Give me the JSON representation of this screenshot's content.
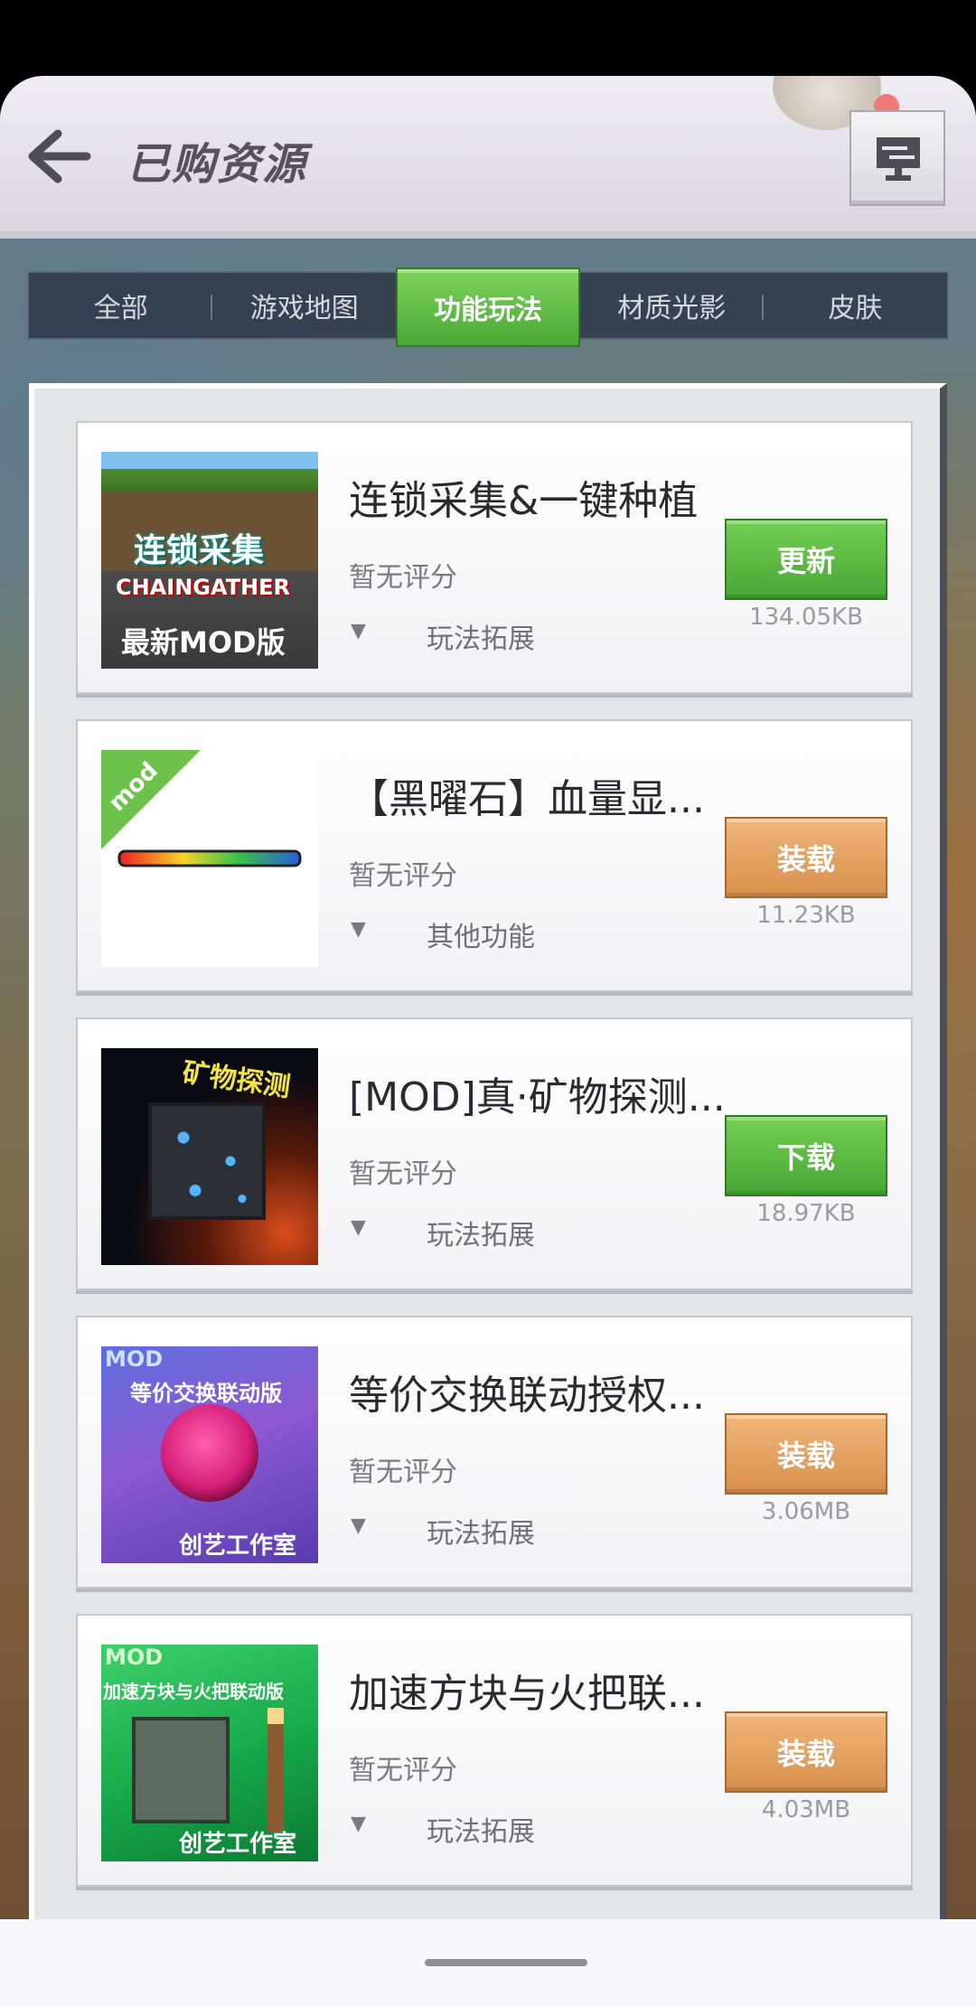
{
  "header": {
    "title": "已购资源",
    "back_icon": "arrow-left-icon",
    "menu_icon": "monitor-settings-icon"
  },
  "tabs": [
    {
      "label": "全部",
      "active": false
    },
    {
      "label": "游戏地图",
      "active": false
    },
    {
      "label": "功能玩法",
      "active": true
    },
    {
      "label": "材质光影",
      "active": false
    },
    {
      "label": "皮肤",
      "active": false
    }
  ],
  "items": [
    {
      "title": "连锁采集&一键种植",
      "rating": "暂无评分",
      "category": "玩法拓展",
      "action": "更新",
      "action_color": "#4aa836",
      "size": "134.05KB",
      "thumb_text": [
        "连锁采集",
        "CHAINGATHER",
        "最新MOD版"
      ]
    },
    {
      "title": "【黑曜石】血量显...",
      "rating": "暂无评分",
      "category": "其他功能",
      "action": "装载",
      "action_color": "#d88f4b",
      "size": "11.23KB",
      "thumb_text": [
        "mod"
      ]
    },
    {
      "title": "[MOD]真·矿物探测...",
      "rating": "暂无评分",
      "category": "玩法拓展",
      "action": "下载",
      "action_color": "#4aa836",
      "size": "18.97KB",
      "thumb_text": [
        "矿物探测"
      ]
    },
    {
      "title": "等价交换联动授权...",
      "rating": "暂无评分",
      "category": "玩法拓展",
      "action": "装载",
      "action_color": "#d88f4b",
      "size": "3.06MB",
      "thumb_text": [
        "MOD",
        "等价交换联动版",
        "创艺工作室"
      ]
    },
    {
      "title": "加速方块与火把联...",
      "rating": "暂无评分",
      "category": "玩法拓展",
      "action": "装载",
      "action_color": "#d88f4b",
      "size": "4.03MB",
      "thumb_text": [
        "MOD",
        "加速方块与火把联动版",
        "创艺工作室"
      ]
    }
  ]
}
